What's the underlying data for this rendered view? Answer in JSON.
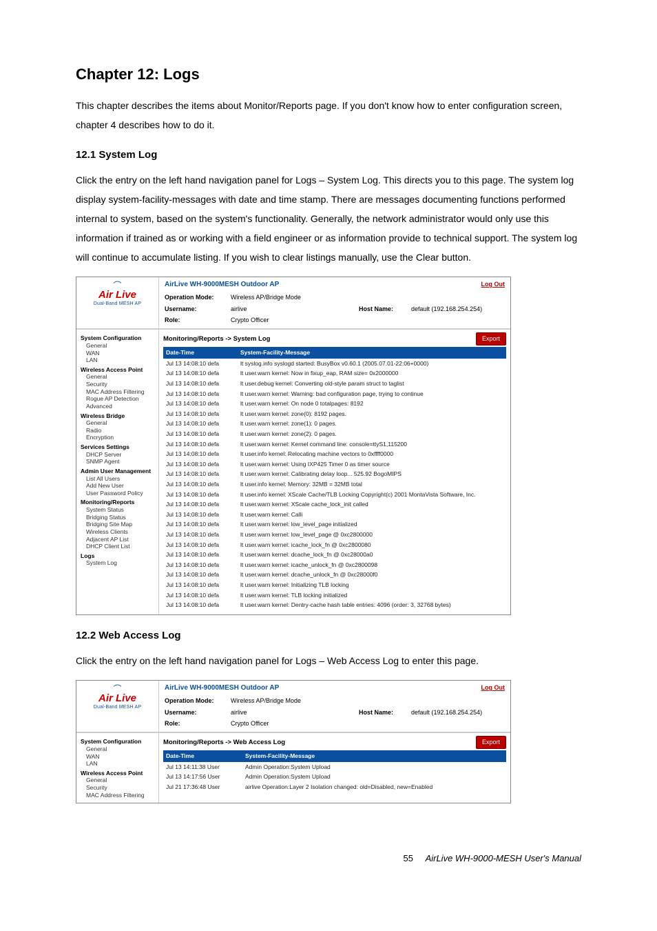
{
  "doc": {
    "h1": "Chapter 12: Logs",
    "intro": "This chapter describes the items about Monitor/Reports page. If you don't know how to enter configuration screen, chapter 4 describes how to do it.",
    "s1": {
      "h2": "12.1 System Log",
      "p": "Click the entry on the left hand navigation panel for Logs – System Log. This directs you to this page. The system log display system-facility-messages with date and time stamp. There are messages documenting functions performed internal to system, based on the system's functionality. Generally, the network administrator would only use this information if trained as or working with a field engineer or as information provide to technical support. The system log will continue to accumulate listing. If you wish to clear listings manually, use the Clear button."
    },
    "s2": {
      "h2": "12.2 Web Access Log",
      "p": "Click the entry on the left hand navigation panel for Logs – Web Access Log to enter this page."
    },
    "footer": {
      "page": "55",
      "manual": "AirLive WH-9000-MESH User's Manual"
    }
  },
  "ap": {
    "title": "AirLive WH-9000MESH Outdoor AP",
    "logout": "Log Out",
    "logo_brand": "Air Live",
    "logo_sub": "Dual-Band MESH AP",
    "labels": {
      "op_mode": "Operation Mode:",
      "username": "Username:",
      "role": "Role:",
      "host": "Host Name:"
    },
    "values": {
      "op_mode": "Wireless AP/Bridge Mode",
      "username": "airlive",
      "role": "Crypto Officer",
      "host": "default (192.168.254.254)"
    },
    "export_btn": "Export",
    "nav_full": [
      {
        "t": "grp",
        "l": "System Configuration"
      },
      {
        "t": "itm",
        "l": "General"
      },
      {
        "t": "itm",
        "l": "WAN"
      },
      {
        "t": "itm",
        "l": "LAN"
      },
      {
        "t": "grp",
        "l": "Wireless Access Point"
      },
      {
        "t": "itm",
        "l": "General"
      },
      {
        "t": "itm",
        "l": "Security"
      },
      {
        "t": "itm",
        "l": "MAC Address Filtering"
      },
      {
        "t": "itm",
        "l": "Rogue AP Detection"
      },
      {
        "t": "itm",
        "l": "Advanced"
      },
      {
        "t": "grp",
        "l": "Wireless Bridge"
      },
      {
        "t": "itm",
        "l": "General"
      },
      {
        "t": "itm",
        "l": "Radio"
      },
      {
        "t": "itm",
        "l": "Encryption"
      },
      {
        "t": "grp",
        "l": "Services Settings"
      },
      {
        "t": "itm",
        "l": "DHCP Server"
      },
      {
        "t": "itm",
        "l": "SNMP Agent"
      },
      {
        "t": "grp",
        "l": "Admin User Management"
      },
      {
        "t": "itm",
        "l": "List All Users"
      },
      {
        "t": "itm",
        "l": "Add New User"
      },
      {
        "t": "itm",
        "l": "User Password Policy"
      },
      {
        "t": "grp",
        "l": "Monitoring/Reports"
      },
      {
        "t": "itm",
        "l": "System Status"
      },
      {
        "t": "itm",
        "l": "Bridging Status"
      },
      {
        "t": "itm",
        "l": "Bridging Site Map"
      },
      {
        "t": "itm",
        "l": "Wireless Clients"
      },
      {
        "t": "itm",
        "l": "Adjacent AP List"
      },
      {
        "t": "itm",
        "l": "DHCP Client List"
      },
      {
        "t": "grp",
        "l": "Logs"
      },
      {
        "t": "itm",
        "l": "System Log"
      }
    ],
    "nav_short": [
      {
        "t": "grp",
        "l": "System Configuration"
      },
      {
        "t": "itm",
        "l": "General"
      },
      {
        "t": "itm",
        "l": "WAN"
      },
      {
        "t": "itm",
        "l": "LAN"
      },
      {
        "t": "grp",
        "l": "Wireless Access Point"
      },
      {
        "t": "itm",
        "l": "General"
      },
      {
        "t": "itm",
        "l": "Security"
      },
      {
        "t": "itm",
        "l": "MAC Address Filtering"
      }
    ],
    "syslog": {
      "crumb": "Monitoring/Reports -> System Log",
      "th_date": "Date-Time",
      "th_msg": "System-Facility-Message",
      "rows": [
        {
          "d": "Jul 13 14:08:10 defa",
          "m": "lt syslog.info syslogd started: BusyBox v0.60.1 (2005.07.01-22:06+0000)"
        },
        {
          "d": "Jul 13 14:08:10 defa",
          "m": "lt user.warn kernel: Now in fixup_eap, RAM size= 0x2000000"
        },
        {
          "d": "Jul 13 14:08:10 defa",
          "m": "lt user.debug kernel: Converting old-style param struct to taglist"
        },
        {
          "d": "Jul 13 14:08:10 defa",
          "m": "lt user.warn kernel: Warning: bad configuration page, trying to continue"
        },
        {
          "d": "Jul 13 14:08:10 defa",
          "m": "lt user.warn kernel: On node 0 totalpages: 8192"
        },
        {
          "d": "Jul 13 14:08:10 defa",
          "m": "lt user.warn kernel: zone(0): 8192 pages."
        },
        {
          "d": "Jul 13 14:08:10 defa",
          "m": "lt user.warn kernel: zone(1): 0 pages."
        },
        {
          "d": "Jul 13 14:08:10 defa",
          "m": "lt user.warn kernel: zone(2): 0 pages."
        },
        {
          "d": "Jul 13 14:08:10 defa",
          "m": "lt user.warn kernel: Kernel command line: console=ttyS1,115200"
        },
        {
          "d": "Jul 13 14:08:10 defa",
          "m": "lt user.info kernel: Relocating machine vectors to 0xffff0000"
        },
        {
          "d": "Jul 13 14:08:10 defa",
          "m": "lt user.warn kernel: Using IXP425 Timer 0 as timer source"
        },
        {
          "d": "Jul 13 14:08:10 defa",
          "m": "lt user.warn kernel: Calibrating delay loop... 525.92 BogoMIPS"
        },
        {
          "d": "Jul 13 14:08:10 defa",
          "m": "lt user.info kernel: Memory: 32MB = 32MB total"
        },
        {
          "d": "Jul 13 14:08:10 defa",
          "m": "lt user.info kernel: XScale Cache/TLB Locking Copyright(c) 2001 MontaVista Software, Inc."
        },
        {
          "d": "Jul 13 14:08:10 defa",
          "m": "lt user.warn kernel: XScale cache_lock_init called"
        },
        {
          "d": "Jul 13 14:08:10 defa",
          "m": "lt user.warn kernel: Calli"
        },
        {
          "d": "Jul 13 14:08:10 defa",
          "m": "lt user.warn kernel: low_level_page initialized"
        },
        {
          "d": "Jul 13 14:08:10 defa",
          "m": "lt user.warn kernel: low_level_page @ 0xc2800000"
        },
        {
          "d": "Jul 13 14:08:10 defa",
          "m": "lt user.warn kernel: icache_lock_fn @ 0xc2800080"
        },
        {
          "d": "Jul 13 14:08:10 defa",
          "m": "lt user.warn kernel: dcache_lock_fn @ 0xc28000a0"
        },
        {
          "d": "Jul 13 14:08:10 defa",
          "m": "lt user.warn kernel: icache_unlock_fn @ 0xc2800098"
        },
        {
          "d": "Jul 13 14:08:10 defa",
          "m": "lt user.warn kernel: dcache_unlock_fn @ 0xc28000f0"
        },
        {
          "d": "Jul 13 14:08:10 defa",
          "m": "lt user.warn kernel: Initializing TLB locking"
        },
        {
          "d": "Jul 13 14:08:10 defa",
          "m": "lt user.warn kernel: TLB locking initialized"
        },
        {
          "d": "Jul 13 14:08:10 defa",
          "m": "lt user.warn kernel: Dentry-cache hash table entries: 4096 (order: 3, 32768 bytes)"
        }
      ]
    },
    "weblog": {
      "crumb": "Monitoring/Reports -> Web Access Log",
      "th_date": "Date-Time",
      "th_msg": "System-Facility-Message",
      "rows": [
        {
          "d": "Jul 13 14:11:38 User",
          "m": "Admin Operation:System Upload"
        },
        {
          "d": "Jul 13 14:17:56 User",
          "m": "Admin Operation:System Upload"
        },
        {
          "d": "Jul 21 17:36:48 User",
          "m": "airlive Operation:Layer 2 Isolation changed: old=Disabled, new=Enabled"
        }
      ]
    }
  }
}
